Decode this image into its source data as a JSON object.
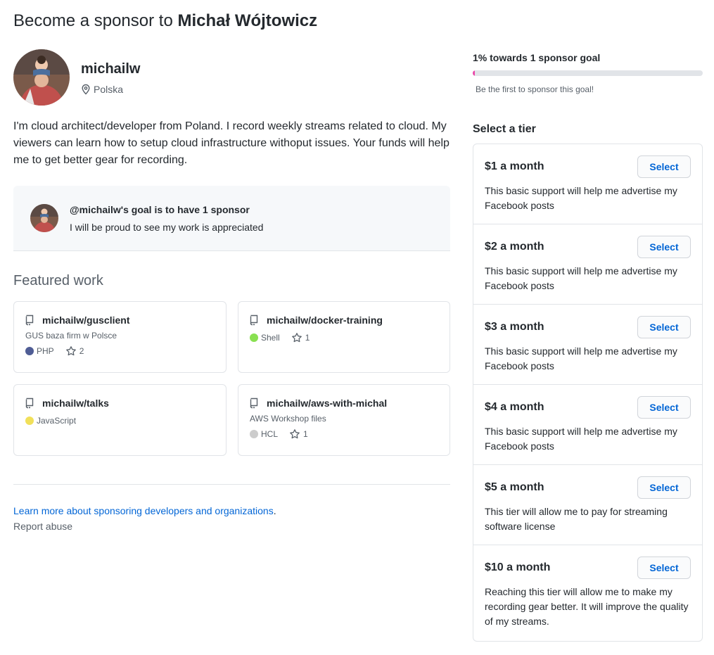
{
  "header": {
    "title_prefix": "Become a sponsor to ",
    "title_name": "Michał Wójtowicz"
  },
  "profile": {
    "username": "michailw",
    "location": "Polska",
    "bio": "I'm cloud architect/developer from Poland. I record weekly streams related to cloud. My viewers can learn how to setup cloud infrastructure withoput issues. Your funds will help me to get better gear for recording."
  },
  "goal": {
    "heading": "@michailw's goal is to have 1 sponsor",
    "description": "I will be proud to see my work is appreciated",
    "progress_label": "1% towards 1 sponsor goal",
    "progress_percent": 1,
    "progress_note": "Be the first to sponsor this goal!"
  },
  "featured": {
    "heading": "Featured work",
    "repos": [
      {
        "name": "michailw/gusclient",
        "description": "GUS baza firm w Polsce",
        "language": "PHP",
        "language_color": "#4F5D95",
        "stars": "2"
      },
      {
        "name": "michailw/docker-training",
        "description": "",
        "language": "Shell",
        "language_color": "#89e051",
        "stars": "1"
      },
      {
        "name": "michailw/talks",
        "description": "",
        "language": "JavaScript",
        "language_color": "#f1e05a",
        "stars": ""
      },
      {
        "name": "michailw/aws-with-michal",
        "description": "AWS Workshop files",
        "language": "HCL",
        "language_color": "#cccccc",
        "stars": "1"
      }
    ]
  },
  "footer": {
    "learn_more": "Learn more about sponsoring developers and organizations",
    "learn_more_suffix": ".",
    "report": "Report abuse"
  },
  "tiers": {
    "heading": "Select a tier",
    "select_label": "Select",
    "items": [
      {
        "price": "$1 a month",
        "description": "This basic support will help me advertise my Facebook posts"
      },
      {
        "price": "$2 a month",
        "description": "This basic support will help me advertise my Facebook posts"
      },
      {
        "price": "$3 a month",
        "description": "This basic support will help me advertise my Facebook posts"
      },
      {
        "price": "$4 a month",
        "description": "This basic support will help me advertise my Facebook posts"
      },
      {
        "price": "$5 a month",
        "description": "This tier will allow me to pay for streaming software license"
      },
      {
        "price": "$10 a month",
        "description": "Reaching this tier will allow me to make my recording gear better. It will improve the quality of my streams."
      }
    ]
  },
  "colors": {
    "link": "#0366d6",
    "progress": "#ea4aaa",
    "border": "#e1e4e8"
  }
}
